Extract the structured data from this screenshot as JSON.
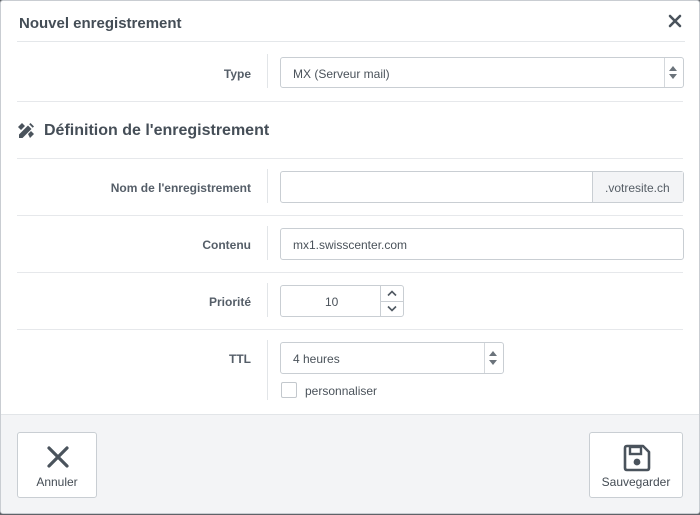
{
  "dialog": {
    "title": "Nouvel enregistrement"
  },
  "type_row": {
    "label": "Type",
    "selected": "MX (Serveur mail)"
  },
  "section": {
    "title": "Définition de l'enregistrement"
  },
  "name_row": {
    "label": "Nom de l'enregistrement",
    "value": "",
    "suffix": ".votresite.ch"
  },
  "content_row": {
    "label": "Contenu",
    "value": "mx1.swisscenter.com"
  },
  "priority_row": {
    "label": "Priorité",
    "value": "10"
  },
  "ttl_row": {
    "label": "TTL",
    "selected": "4 heures",
    "custom_label": "personnaliser"
  },
  "footer": {
    "cancel_label": "Annuler",
    "save_label": "Sauvegarder"
  },
  "colors": {
    "text": "#3c4650",
    "border": "#c9ced3",
    "footer_bg": "#f3f4f6"
  },
  "icons": [
    "close-icon",
    "pencil-ruler-icon",
    "x-icon",
    "floppy-disk-icon",
    "chevron-up-icon",
    "chevron-down-icon"
  ]
}
